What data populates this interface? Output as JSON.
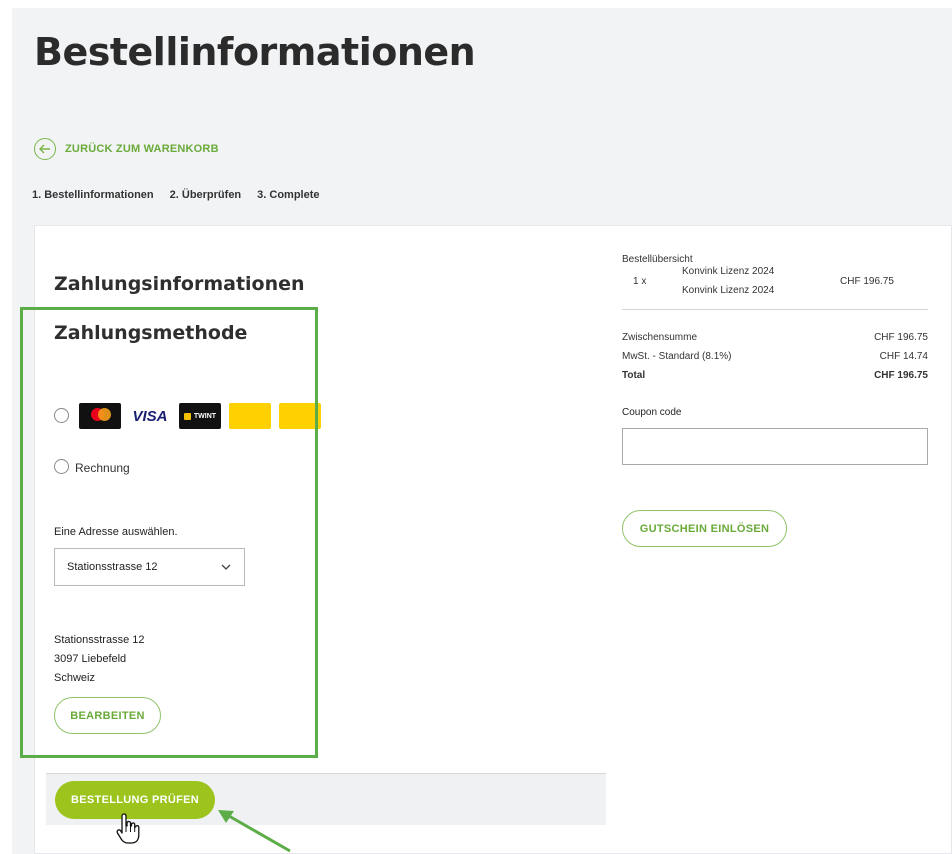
{
  "page": {
    "title": "Bestellinformationen",
    "back_link": "ZURÜCK ZUM WARENKORB",
    "steps": [
      "1. Bestellinformationen",
      "2. Überprüfen",
      "3. Complete"
    ]
  },
  "payment": {
    "section_title": "Zahlungsinformationen",
    "method_title": "Zahlungsmethode",
    "card_logos": [
      "mastercard",
      "visa",
      "twint",
      "postfinance-card",
      "postfinance-efinance"
    ],
    "twint_label": "TWINT",
    "visa_label": "VISA",
    "invoice_label": "Rechnung",
    "address_label": "Eine Adresse auswählen.",
    "address_selected": "Stationsstrasse 12",
    "address_lines": [
      "Stationsstrasse 12",
      "3097 Liebefeld",
      "Schweiz"
    ],
    "edit_button": "BEARBEITEN",
    "review_button": "BESTELLUNG PRÜFEN"
  },
  "summary": {
    "title": "Bestellübersicht",
    "item": {
      "qty": "1 x",
      "name": "Konvink Lizenz 2024",
      "variant": "Konvink Lizenz 2024",
      "price": "CHF 196.75"
    },
    "subtotal_label": "Zwischensumme",
    "subtotal": "CHF 196.75",
    "tax_label": "MwSt. - Standard (8.1%)",
    "tax": "CHF 14.74",
    "total_label": "Total",
    "total": "CHF 196.75",
    "coupon_label": "Coupon code",
    "coupon_value": "",
    "coupon_button": "GUTSCHEIN EINLÖSEN"
  },
  "colors": {
    "accent_green": "#6aaa3a",
    "primary_button": "#9cc41c",
    "highlight_frame": "#5cad47",
    "page_bg": "#f2f3f5"
  }
}
